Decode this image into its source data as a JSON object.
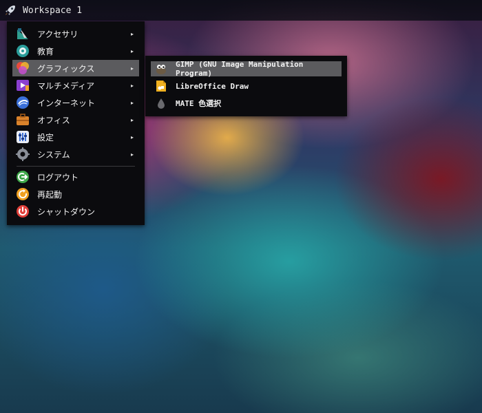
{
  "panel": {
    "workspace_label": "Workspace 1",
    "launcher_icon": "rocket-icon"
  },
  "menu": {
    "items": [
      {
        "label": "アクセサリ",
        "icon": "accessories-icon",
        "has_submenu": true
      },
      {
        "label": "教育",
        "icon": "education-icon",
        "has_submenu": true
      },
      {
        "label": "グラフィックス",
        "icon": "graphics-icon",
        "has_submenu": true,
        "active": true
      },
      {
        "label": "マルチメディア",
        "icon": "multimedia-icon",
        "has_submenu": true
      },
      {
        "label": "インターネット",
        "icon": "internet-icon",
        "has_submenu": true
      },
      {
        "label": "オフィス",
        "icon": "office-icon",
        "has_submenu": true
      },
      {
        "label": "設定",
        "icon": "settings-icon",
        "has_submenu": true
      },
      {
        "label": "システム",
        "icon": "system-icon",
        "has_submenu": true
      },
      {
        "label": "ログアウト",
        "icon": "logout-icon",
        "has_submenu": false
      },
      {
        "label": "再起動",
        "icon": "reboot-icon",
        "has_submenu": false
      },
      {
        "label": "シャットダウン",
        "icon": "shutdown-icon",
        "has_submenu": false
      }
    ],
    "submenu_arrow": "▸"
  },
  "submenu": {
    "items": [
      {
        "label": "GIMP (GNU Image Manipulation Program)",
        "icon": "gimp-icon",
        "active": true
      },
      {
        "label": "LibreOffice Draw",
        "icon": "libreoffice-draw-icon"
      },
      {
        "label": "MATE 色選択",
        "icon": "color-picker-icon"
      }
    ]
  },
  "colors": {
    "menu_bg": "#0b0b0e",
    "highlight": "#5b5b5e",
    "text": "#f2f2f2"
  }
}
